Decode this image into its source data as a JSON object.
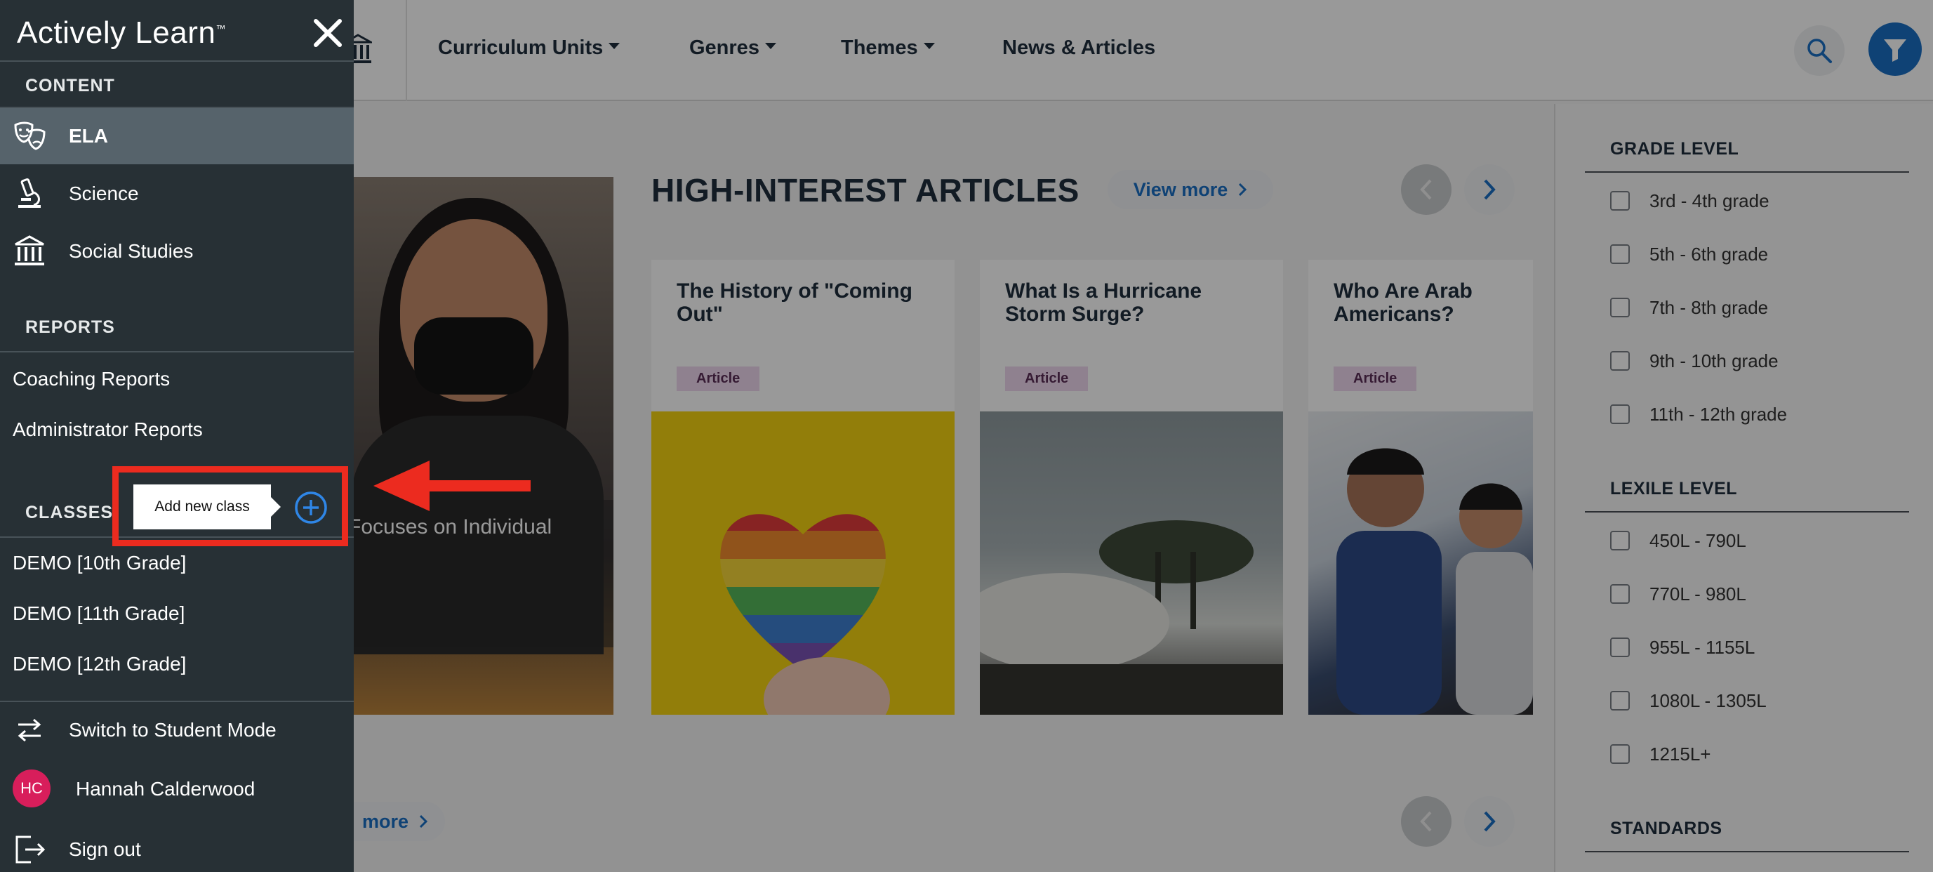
{
  "topnav": {
    "items": [
      {
        "label": "Curriculum Units",
        "dropdown": true
      },
      {
        "label": "Genres",
        "dropdown": true
      },
      {
        "label": "Themes",
        "dropdown": true
      },
      {
        "label": "News & Articles",
        "dropdown": false
      }
    ]
  },
  "main": {
    "hero_caption": "Focuses on Individual",
    "section_title": "HIGH-INTEREST ARTICLES",
    "view_more_label": "View more",
    "view_more_partial_label": "more",
    "cards": [
      {
        "title": "The History of \"Coming Out\"",
        "tag": "Article"
      },
      {
        "title": "What Is a Hurricane Storm Surge?",
        "tag": "Article"
      },
      {
        "title": "Who Are Arab Americans?",
        "tag": "Article"
      }
    ]
  },
  "filters": {
    "grade_level": {
      "heading": "GRADE LEVEL",
      "options": [
        "3rd - 4th grade",
        "5th - 6th grade",
        "7th - 8th grade",
        "9th - 10th grade",
        "11th - 12th grade"
      ]
    },
    "lexile_level": {
      "heading": "LEXILE LEVEL",
      "options": [
        "450L - 790L",
        "770L - 980L",
        "955L - 1155L",
        "1080L - 1305L",
        "1215L+"
      ]
    },
    "standards": {
      "heading": "STANDARDS"
    }
  },
  "sidebar": {
    "brand": "Actively Learn",
    "content_label": "CONTENT",
    "content_items": [
      {
        "label": "ELA",
        "icon": "theater-masks-icon",
        "active": true
      },
      {
        "label": "Science",
        "icon": "microscope-icon",
        "active": false
      },
      {
        "label": "Social Studies",
        "icon": "museum-icon",
        "active": false
      }
    ],
    "reports_label": "REPORTS",
    "reports_items": [
      "Coaching Reports",
      "Administrator Reports"
    ],
    "classes_label": "CLASSES",
    "classes_items": [
      "DEMO [10th Grade]",
      "DEMO [11th Grade]",
      "DEMO [12th Grade]"
    ],
    "switch_mode_label": "Switch to Student Mode",
    "user_initials": "HC",
    "user_name": "Hannah Calderwood",
    "sign_out_label": "Sign out"
  },
  "tooltip": {
    "text": "Add new class"
  },
  "colors": {
    "drawer_bg": "#273035",
    "active_row": "#56636b",
    "accent_blue": "#1a6fc4",
    "callout_red": "#ec2b1f",
    "avatar": "#d81e5b",
    "tag_bg": "#efd7ee"
  }
}
